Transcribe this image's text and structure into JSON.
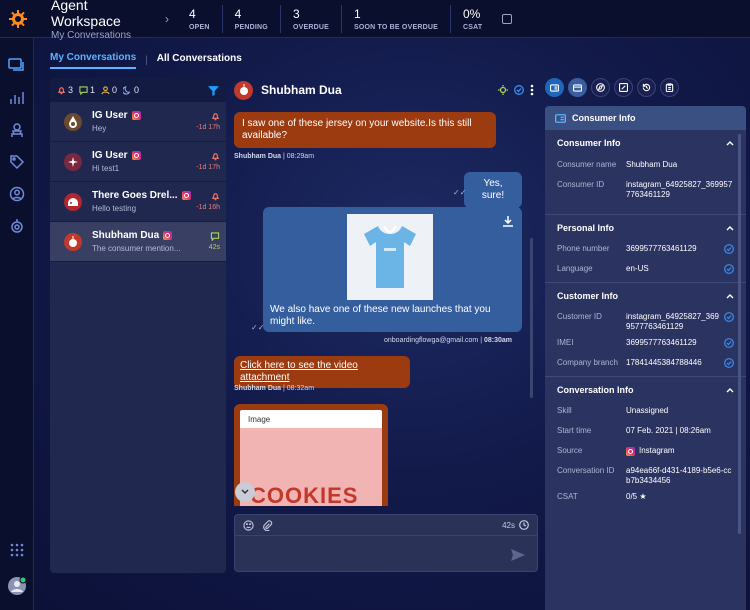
{
  "header": {
    "title": "Agent Workspace",
    "subtitle": "My Conversations",
    "stats": [
      {
        "value": "4",
        "label": "OPEN"
      },
      {
        "value": "4",
        "label": "PENDING"
      },
      {
        "value": "3",
        "label": "OVERDUE"
      },
      {
        "value": "1",
        "label": "SOON TO BE OVERDUE"
      },
      {
        "value": "0%",
        "label": "CSAT"
      }
    ]
  },
  "tabs": {
    "my": "My Conversations",
    "all": "All Conversations"
  },
  "counters": {
    "alerts": "3",
    "messages": "1",
    "users": "0",
    "snoozed": "0"
  },
  "conversations": [
    {
      "name": "IG User",
      "preview": "Hey",
      "time": "-1d 17h",
      "avatar_color": "#6b4a2e"
    },
    {
      "name": "IG User",
      "preview": "Hi test1",
      "time": "-1d 17h",
      "avatar_color": "#7a2840"
    },
    {
      "name": "There Goes Drel...",
      "preview": "Hello testing",
      "time": "-1d 16h",
      "avatar_color": "#b2262e"
    },
    {
      "name": "Shubham Dua",
      "preview": "The consumer mention...",
      "time": "42s",
      "avatar_color": "#c0392b"
    }
  ],
  "chat": {
    "contact": "Shubham Dua",
    "msg1": "I saw one of these jersey on your website.Is this still available?",
    "meta1_name": "Shubham Dua",
    "meta1_time": "08:29am",
    "msg2": "Yes, sure!",
    "msg3": "We also have one of these new launches that you might like.",
    "meta3_email": "onboardingflowga@gmail.com",
    "meta3_time": "08:30am",
    "msg4": "Click here to see the video attachment",
    "meta4_name": "Shubham Dua",
    "meta4_time": "08:32am",
    "card_label": "Image",
    "card_text": "COOKIES",
    "timer": "42s"
  },
  "consumer_panel": {
    "title": "Consumer Info",
    "sections": {
      "consumer": "Consumer Info",
      "personal": "Personal Info",
      "customer": "Customer Info",
      "conversation": "Conversation Info"
    },
    "consumer_name_label": "Consumer name",
    "consumer_name": "Shubham Dua",
    "consumer_id_label": "Consumer ID",
    "consumer_id": "instagram_64925827_3699577763461129",
    "phone_label": "Phone number",
    "phone": "3699577763461129",
    "language_label": "Language",
    "language": "en-US",
    "customer_id_label": "Customer ID",
    "customer_id": "instagram_64925827_3699577763461129",
    "imei_label": "IMEI",
    "imei": "3699577763461129",
    "branch_label": "Company branch",
    "branch": "17841445384788446",
    "skill_label": "Skill",
    "skill": "Unassigned",
    "start_label": "Start time",
    "start": "07 Feb. 2021 | 08:26am",
    "source_label": "Source",
    "source": "Instagram",
    "convid_label": "Conversation ID",
    "convid": "a94ea66f-d431-4189-b5e6-ccb7b3434456",
    "csat_label": "CSAT",
    "csat": "0/5"
  },
  "colors": {
    "accent": "#5ab4ff",
    "agent_bubble": "#355e9e",
    "consumer_bubble": "#9c3a10",
    "ok": "#3a8ff0"
  }
}
